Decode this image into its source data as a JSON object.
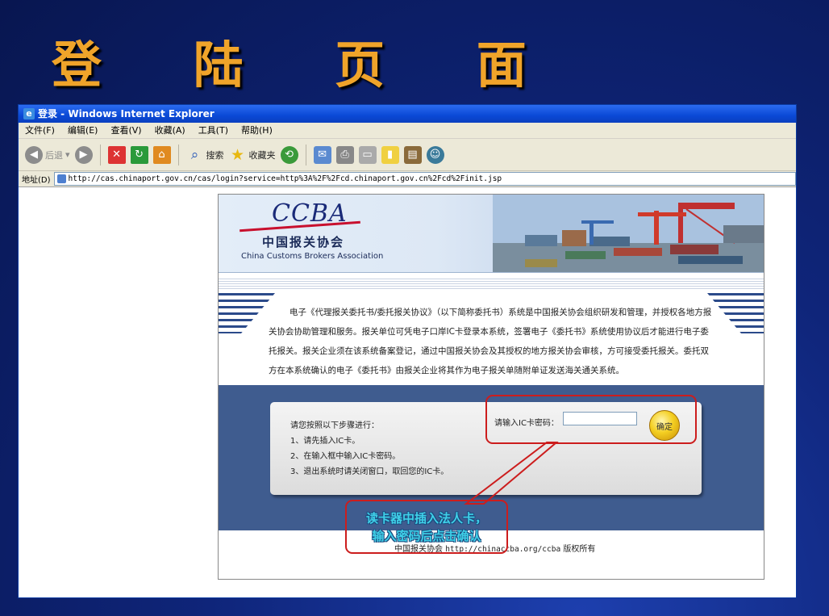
{
  "slide": {
    "title": "登 陆 页 面"
  },
  "browser": {
    "window_title": "登录 - Windows Internet Explorer",
    "menu": [
      "文件(F)",
      "编辑(E)",
      "查看(V)",
      "收藏(A)",
      "工具(T)",
      "帮助(H)"
    ],
    "toolbar": {
      "back_label": "后退",
      "search_label": "搜索",
      "favorites_label": "收藏夹"
    },
    "address_label": "地址(D)",
    "url": "http://cas.chinaport.gov.cn/cas/login?service=http%3A%2F%2Fcd.chinaport.gov.cn%2Fcd%2Finit.jsp"
  },
  "page": {
    "logo_text": "CCBA",
    "org_cn": "中国报关协会",
    "org_en": "China Customs Brokers Association",
    "intro": "电子《代理报关委托书/委托报关协议》（以下简称委托书）系统是中国报关协会组织研发和管理，并授权各地方报关协会协助管理和服务。报关单位可凭电子口岸IC卡登录本系统，签署电子《委托书》系统使用协议后才能进行电子委托报关。报关企业须在该系统备案登记，通过中国报关协会及其授权的地方报关协会审核，方可接受委托报关。委托双方在本系统确认的电子《委托书》由报关企业将其作为电子报关单随附单证发送海关通关系统。",
    "steps_title": "请您按照以下步骤进行：",
    "steps": [
      "1、请先插入IC卡。",
      "2、在输入框中输入IC卡密码。",
      "3、退出系统时请关闭窗口，取回您的IC卡。"
    ],
    "password_label": "请输入IC卡密码：",
    "password_value": "",
    "ok_button": "确定",
    "footer_org": "中国报关协会",
    "footer_url": "http://chinaccba.org/ccba",
    "footer_rights": "版权所有"
  },
  "annotation": {
    "line1": "读卡器中插入法人卡，",
    "line2": "输入密码后点击确认"
  },
  "colors": {
    "title": "#f0a42a",
    "callout_border": "#cc1d1d",
    "callout_text": "#3fd0e8",
    "login_bg": "#3f5c8f"
  }
}
